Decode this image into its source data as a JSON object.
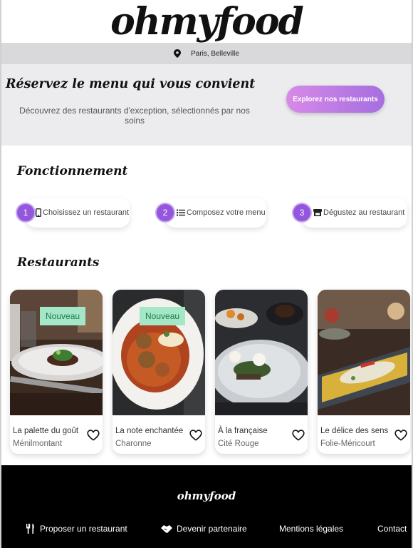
{
  "brand": {
    "name": "ohmyfood"
  },
  "location": {
    "text": "Paris, Belleville",
    "icon": "map-pin-icon"
  },
  "hero": {
    "title": "Réservez le menu qui vous convient",
    "subtitle": "Découvrez des restaurants d'exception, sélectionnés par nos soins",
    "cta_label": "Explorez nos restaurants"
  },
  "how_it_works": {
    "title": "Fonctionnement",
    "steps": [
      {
        "num": "1",
        "label": "Choisissez un restaurant",
        "icon": "mobile-phone-icon"
      },
      {
        "num": "2",
        "label": "Composez votre menu",
        "icon": "list-icon"
      },
      {
        "num": "3",
        "label": "Dégustez au restaurant",
        "icon": "store-icon"
      }
    ]
  },
  "restaurants": {
    "title": "Restaurants",
    "badge_label": "Nouveau",
    "items": [
      {
        "name": "La palette du goût",
        "area": "Ménilmontant",
        "is_new": true
      },
      {
        "name": "La note enchantée",
        "area": "Charonne",
        "is_new": true
      },
      {
        "name": "À la française",
        "area": "Cité Rouge",
        "is_new": false
      },
      {
        "name": "Le délice des sens",
        "area": "Folie-Méricourt",
        "is_new": false
      }
    ]
  },
  "footer": {
    "logo": "ohmyfood",
    "links": [
      {
        "label": "Proposer un restaurant",
        "icon": "utensils-icon"
      },
      {
        "label": "Devenir partenaire",
        "icon": "handshake-icon"
      },
      {
        "label": "Mentions légales",
        "icon": ""
      },
      {
        "label": "Contact",
        "icon": ""
      }
    ]
  },
  "colors": {
    "accent": "#9356DC",
    "badge_bg": "#A3E7C7",
    "badge_text": "#1F7A4D",
    "footer_bg": "#000000"
  }
}
